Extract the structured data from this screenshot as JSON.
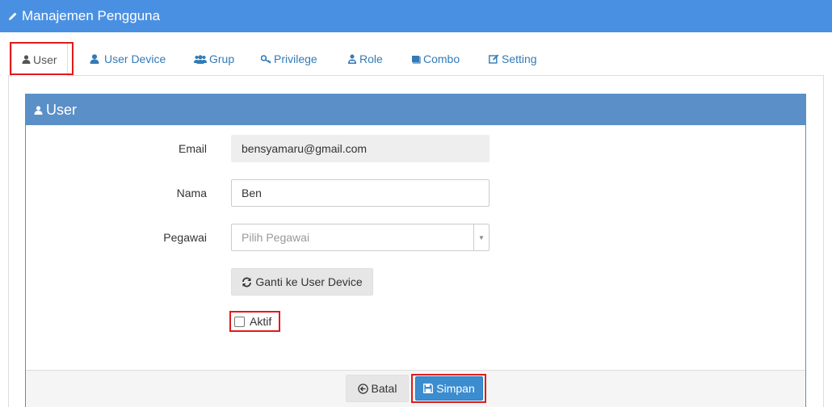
{
  "header": {
    "title": "Manajemen Pengguna",
    "icon": "pencil-icon"
  },
  "tabs": [
    {
      "label": "User",
      "icon": "user-icon",
      "active": true
    },
    {
      "label": "User Device",
      "icon": "user-icon"
    },
    {
      "label": "Grup",
      "icon": "users-icon"
    },
    {
      "label": "Privilege",
      "icon": "key-icon"
    },
    {
      "label": "Role",
      "icon": "user-role-icon"
    },
    {
      "label": "Combo",
      "icon": "book-icon"
    },
    {
      "label": "Setting",
      "icon": "edit-icon"
    }
  ],
  "panel": {
    "title": "User",
    "icon": "user-icon",
    "accent": "#5a8fc7"
  },
  "form": {
    "email": {
      "label": "Email",
      "value": "bensyamaru@gmail.com"
    },
    "nama": {
      "label": "Nama",
      "value": "Ben"
    },
    "pegawai": {
      "label": "Pegawai",
      "placeholder": "Pilih Pegawai"
    },
    "switch_button": "Ganti ke User Device",
    "aktif": {
      "label": "Aktif",
      "checked": false
    }
  },
  "footer": {
    "cancel_label": "Batal",
    "save_label": "Simpan"
  },
  "colors": {
    "header": "#4a90e2",
    "highlight": "#e01b1b",
    "primary": "#3c8dd0"
  }
}
